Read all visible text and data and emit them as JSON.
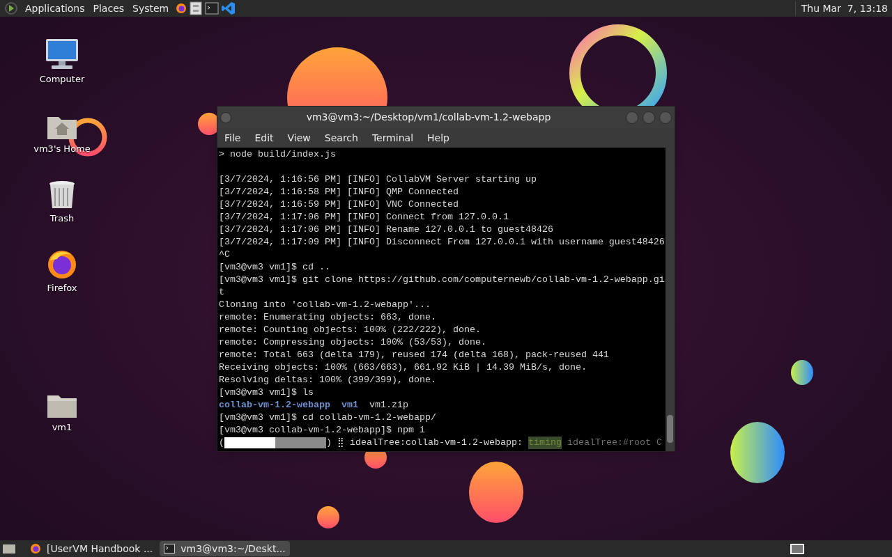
{
  "top_panel": {
    "menus": [
      "Applications",
      "Places",
      "System"
    ],
    "clock": "Thu Mar  7, 13:18"
  },
  "desktop_icons": [
    {
      "kind": "computer",
      "label": "Computer"
    },
    {
      "kind": "home",
      "label": "vm3's Home"
    },
    {
      "kind": "trash",
      "label": "Trash"
    },
    {
      "kind": "firefox",
      "label": "Firefox"
    },
    {
      "kind": "folder",
      "label": "vm1"
    }
  ],
  "terminal": {
    "title": "vm3@vm3:~/Desktop/vm1/collab-vm-1.2-webapp",
    "menu": [
      "File",
      "Edit",
      "View",
      "Search",
      "Terminal",
      "Help"
    ],
    "lines": [
      {
        "kind": "text",
        "text": "> node build/index.js"
      },
      {
        "kind": "blank"
      },
      {
        "kind": "text",
        "text": "[3/7/2024, 1:16:56 PM] [INFO] CollabVM Server starting up"
      },
      {
        "kind": "text",
        "text": "[3/7/2024, 1:16:58 PM] [INFO] QMP Connected"
      },
      {
        "kind": "text",
        "text": "[3/7/2024, 1:16:59 PM] [INFO] VNC Connected"
      },
      {
        "kind": "text",
        "text": "[3/7/2024, 1:17:06 PM] [INFO] Connect from 127.0.0.1"
      },
      {
        "kind": "text",
        "text": "[3/7/2024, 1:17:06 PM] [INFO] Rename 127.0.0.1 to guest48426"
      },
      {
        "kind": "text",
        "text": "[3/7/2024, 1:17:09 PM] [INFO] Disconnect From 127.0.0.1 with username guest48426"
      },
      {
        "kind": "text",
        "text": "^C"
      },
      {
        "kind": "text",
        "text": "[vm3@vm3 vm1]$ cd .."
      },
      {
        "kind": "text",
        "text": "[vm3@vm3 vm1]$ git clone https://github.com/computernewb/collab-vm-1.2-webapp.gi"
      },
      {
        "kind": "text",
        "text": "t"
      },
      {
        "kind": "text",
        "text": "Cloning into 'collab-vm-1.2-webapp'..."
      },
      {
        "kind": "text",
        "text": "remote: Enumerating objects: 663, done."
      },
      {
        "kind": "text",
        "text": "remote: Counting objects: 100% (222/222), done."
      },
      {
        "kind": "text",
        "text": "remote: Compressing objects: 100% (53/53), done."
      },
      {
        "kind": "text",
        "text": "remote: Total 663 (delta 179), reused 174 (delta 168), pack-reused 441"
      },
      {
        "kind": "text",
        "text": "Receiving objects: 100% (663/663), 661.92 KiB | 14.39 MiB/s, done."
      },
      {
        "kind": "text",
        "text": "Resolving deltas: 100% (399/399), done."
      },
      {
        "kind": "text",
        "text": "[vm3@vm3 vm1]$ ls"
      },
      {
        "kind": "listing",
        "entries": [
          {
            "kind": "dir",
            "name": "collab-vm-1.2-webapp"
          },
          {
            "kind": "dir",
            "name": "vm1"
          },
          {
            "kind": "file",
            "name": "vm1.zip"
          }
        ]
      },
      {
        "kind": "text",
        "text": "[vm3@vm3 vm1]$ cd collab-vm-1.2-webapp/"
      },
      {
        "kind": "text",
        "text": "[vm3@vm3 collab-vm-1.2-webapp]$ npm i"
      },
      {
        "kind": "progress",
        "open": "(",
        "level": 0.5,
        "close": ")",
        "spinner": "⣿",
        "stage": "idealTree:collab-vm-1.2-webapp:",
        "tag": "timing",
        "detail": "idealTree:#root C"
      }
    ]
  },
  "taskbar": [
    {
      "kind": "firefox",
      "label": "[UserVM Handbook ...",
      "selected": false
    },
    {
      "kind": "terminal",
      "label": "vm3@vm3:~/Deskt...",
      "selected": true
    }
  ]
}
